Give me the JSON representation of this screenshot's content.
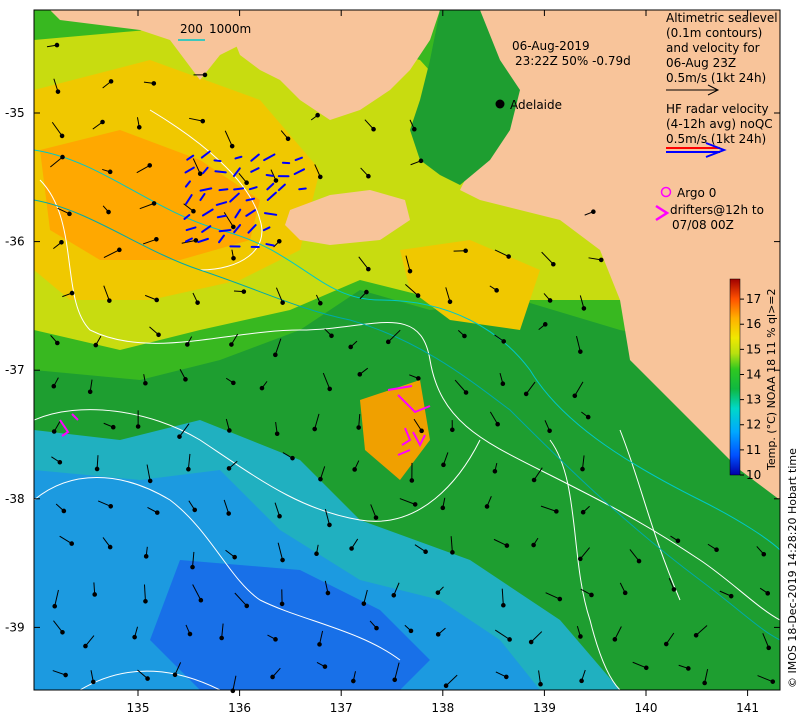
{
  "map": {
    "date": "06-Aug-2019",
    "time_line": "23:22Z  50% -0.79d",
    "place": "Adelaide",
    "depth_labels": [
      "200",
      "1000m"
    ],
    "lon_ticks": [
      "135",
      "136",
      "137",
      "138",
      "139",
      "140",
      "141"
    ],
    "lat_ticks": [
      "-35",
      "-36",
      "-37",
      "-38",
      "-39"
    ]
  },
  "legend": {
    "altimetric": [
      "Altimetric sealevel",
      "(0.1m contours)",
      "and velocity for",
      "06-Aug 23Z",
      "0.5m/s (1kt 24h)"
    ],
    "hf_radar": [
      "HF radar velocity",
      "(4-12h avg) noQC",
      "0.5m/s (1kt 24h)"
    ],
    "argo": "Argo 0",
    "drifters": [
      "drifters@12h to",
      "07/08 00Z"
    ]
  },
  "colorbar": {
    "title": "Temp. (°C) NOAA 18 11 % ql>=2",
    "ticks": [
      "10",
      "11",
      "12",
      "13",
      "14",
      "15",
      "16",
      "17"
    ],
    "min": 10,
    "max": 17.8
  },
  "credit": "© IMOS 18-Dec-2019 14:28:20 Hobart time",
  "colors": {
    "land": "#f8c49a",
    "altimetric_arrow": "#000000",
    "hf_radar_red": "#ff0000",
    "hf_radar_blue": "#0000ff",
    "argo": "#ff00ff",
    "drifter": "#ff00ff",
    "contour": "#ffffff",
    "depth_200": "#00c8c8",
    "depth_1000": "#00aaaa"
  }
}
